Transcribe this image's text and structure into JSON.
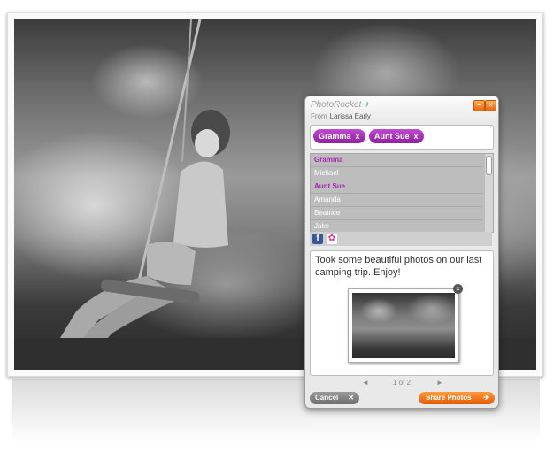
{
  "widget": {
    "brand": "PhotoRocket",
    "from_label": "From",
    "from_name": "Larissa Early",
    "recipients": [
      {
        "name": "Gramma"
      },
      {
        "name": "Aunt Sue"
      }
    ],
    "contacts": [
      {
        "name": "Gramma",
        "selected": true
      },
      {
        "name": "Michael",
        "selected": false
      },
      {
        "name": "Aunt Sue",
        "selected": true
      },
      {
        "name": "Amanda",
        "selected": false
      },
      {
        "name": "Beatrice",
        "selected": false
      },
      {
        "name": "Jake",
        "selected": false
      }
    ],
    "message": "Took some beautiful photos on our last camping trip. Enjoy!",
    "pager": "1 of 2",
    "cancel_label": "Cancel",
    "share_label": "Share Photos"
  },
  "icons": {
    "chip_remove": "x",
    "facebook": "f",
    "flower": "✿",
    "prev": "◄",
    "next": "►",
    "close": "×"
  },
  "colors": {
    "chip": "#a427b4",
    "accent": "#f07a1e",
    "facebook": "#3b5998"
  }
}
